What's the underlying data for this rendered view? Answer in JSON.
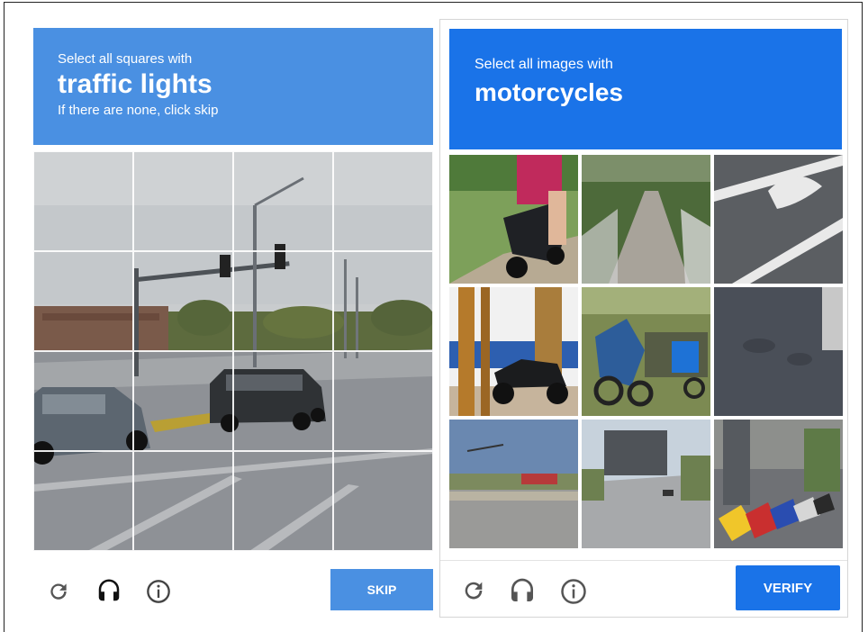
{
  "left_challenge": {
    "instruction": "Select all squares with",
    "target": "traffic lights",
    "hint": "If there are none, click skip",
    "button_label": "SKIP",
    "icons": [
      "reload-icon",
      "audio-icon",
      "info-icon"
    ],
    "accent_color": "#4a90e2"
  },
  "right_challenge": {
    "instruction": "Select all images with",
    "target": "motorcycles",
    "button_label": "VERIFY",
    "icons": [
      "reload-icon",
      "audio-icon",
      "info-icon"
    ],
    "accent_color": "#1a73e8"
  }
}
